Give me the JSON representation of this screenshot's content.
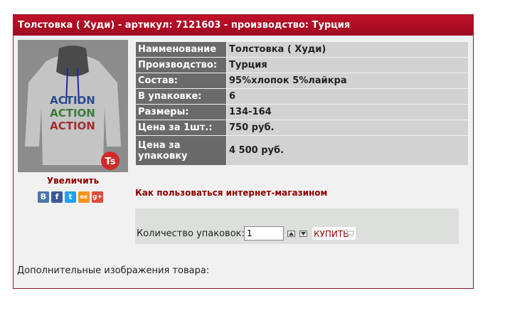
{
  "product": {
    "header_title": "Толстовка ( Худи) - артикул: 7121603 - производство: Турция",
    "zoom_label": "Увеличить",
    "specs": [
      {
        "label": "Наименование",
        "value": "Толстовка ( Худи)"
      },
      {
        "label": "Производство:",
        "value": "Турция"
      },
      {
        "label": "Состав:",
        "value": "95%хлопок 5%лайкра"
      },
      {
        "label": "В упаковке:",
        "value": "6"
      },
      {
        "label": "Размеры:",
        "value": "134-164"
      },
      {
        "label": "Цена за 1шт.:",
        "value": "750 руб."
      },
      {
        "label": "Цена за упаковку",
        "value": "4 500 руб."
      }
    ],
    "howto_link": "Как пользоваться интернет-магазином",
    "order": {
      "qty_label": "Количество упаковок:",
      "qty_value": "1",
      "buy_label": "КУПИТЬ"
    },
    "extra_images_label": "Дополнительные изображения товара:",
    "image_print_text": "ACTION",
    "social": [
      {
        "icon": "vkontakte-icon",
        "glyph": "В",
        "color": "#4a76a8"
      },
      {
        "icon": "facebook-icon",
        "glyph": "f",
        "color": "#3b5998"
      },
      {
        "icon": "twitter-icon",
        "glyph": "t",
        "color": "#1da1f2"
      },
      {
        "icon": "odnoklassniki-icon",
        "glyph": "ок",
        "color": "#f7931e"
      },
      {
        "icon": "google-plus-icon",
        "glyph": "g+",
        "color": "#dd4b39"
      }
    ],
    "colors": {
      "header": "#b00d24",
      "label_bg": "#6a6a6a",
      "value_bg": "#d2d2d2",
      "link": "#8b0000"
    }
  }
}
